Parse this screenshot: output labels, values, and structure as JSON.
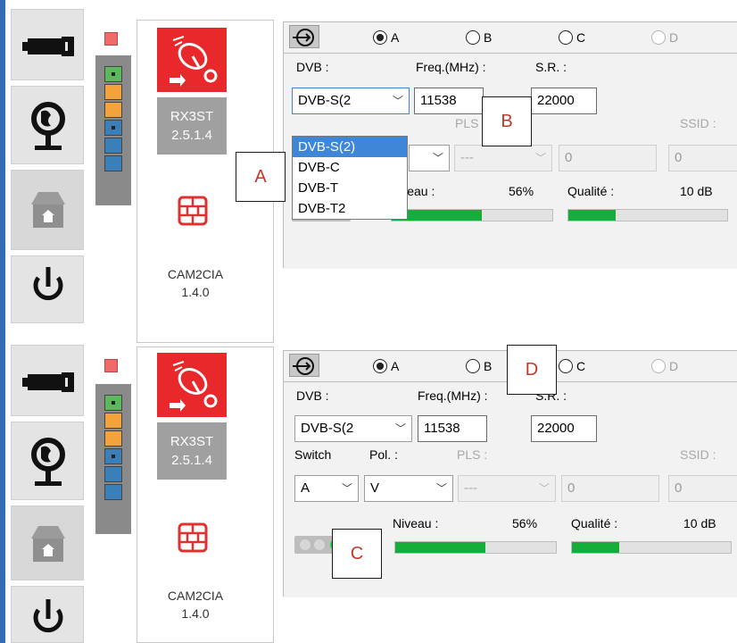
{
  "colors": {
    "accent_blue": "#2f6db4",
    "rx_red": "#e8282b",
    "highlight": "#3d86d8",
    "signal_green": "#16ae3a",
    "callout_text": "#c0392b"
  },
  "sidebar": {
    "buttons": [
      {
        "name": "usb-icon"
      },
      {
        "name": "globe-stand-icon"
      },
      {
        "name": "home-box-icon",
        "disabled": true
      },
      {
        "name": "power-icon"
      }
    ]
  },
  "device": {
    "rx_model": "RX3ST",
    "rx_version": "2.5.1.4",
    "cam_model": "CAM2CIA",
    "cam_version": "1.4.0",
    "led_column": [
      "green",
      "orange",
      "orange",
      "blue",
      "blue",
      "blue"
    ]
  },
  "tuner_top": {
    "radios": [
      "A",
      "B",
      "C",
      "D"
    ],
    "selected": "A",
    "labels": {
      "dvb": "DVB :",
      "freq": "Freq.(MHz) :",
      "sr": "S.R. :",
      "pls": "PLS :",
      "ssid": "SSID :",
      "niveau": "Niveau :",
      "qualite": "Qualité :"
    },
    "dvb_value": "DVB-S(2",
    "freq_value": "11538",
    "sr_value": "22000",
    "pls_value": "---",
    "pls_num": "0",
    "ssid_num": "0",
    "niveau_value": "56%",
    "niveau_level": 0.56,
    "qualite_value": "10 dB",
    "qualite_level": 0.3,
    "dropdown_options": [
      "DVB-S(2)",
      "DVB-C",
      "DVB-T",
      "DVB-T2"
    ],
    "dropdown_selected": "DVB-S(2)"
  },
  "tuner_bottom": {
    "radios": [
      "A",
      "B",
      "C",
      "D"
    ],
    "selected": "A",
    "labels": {
      "dvb": "DVB :",
      "freq": "Freq.(MHz) :",
      "sr": "S.R. :",
      "switch": "Switch",
      "pol": "Pol. :",
      "pls": "PLS :",
      "ssid": "SSID :",
      "niveau": "Niveau :",
      "qualite": "Qualité :"
    },
    "dvb_value": "DVB-S(2",
    "freq_value": "11538",
    "sr_value": "22000",
    "switch_value": "A",
    "pol_value": "V",
    "pls_value": "---",
    "pls_num": "0",
    "ssid_num": "0",
    "niveau_value": "56%",
    "niveau_level": 0.56,
    "qualite_value": "10 dB",
    "qualite_level": 0.3
  },
  "callouts": {
    "a": "A",
    "b": "B",
    "c": "C",
    "d": "D"
  }
}
